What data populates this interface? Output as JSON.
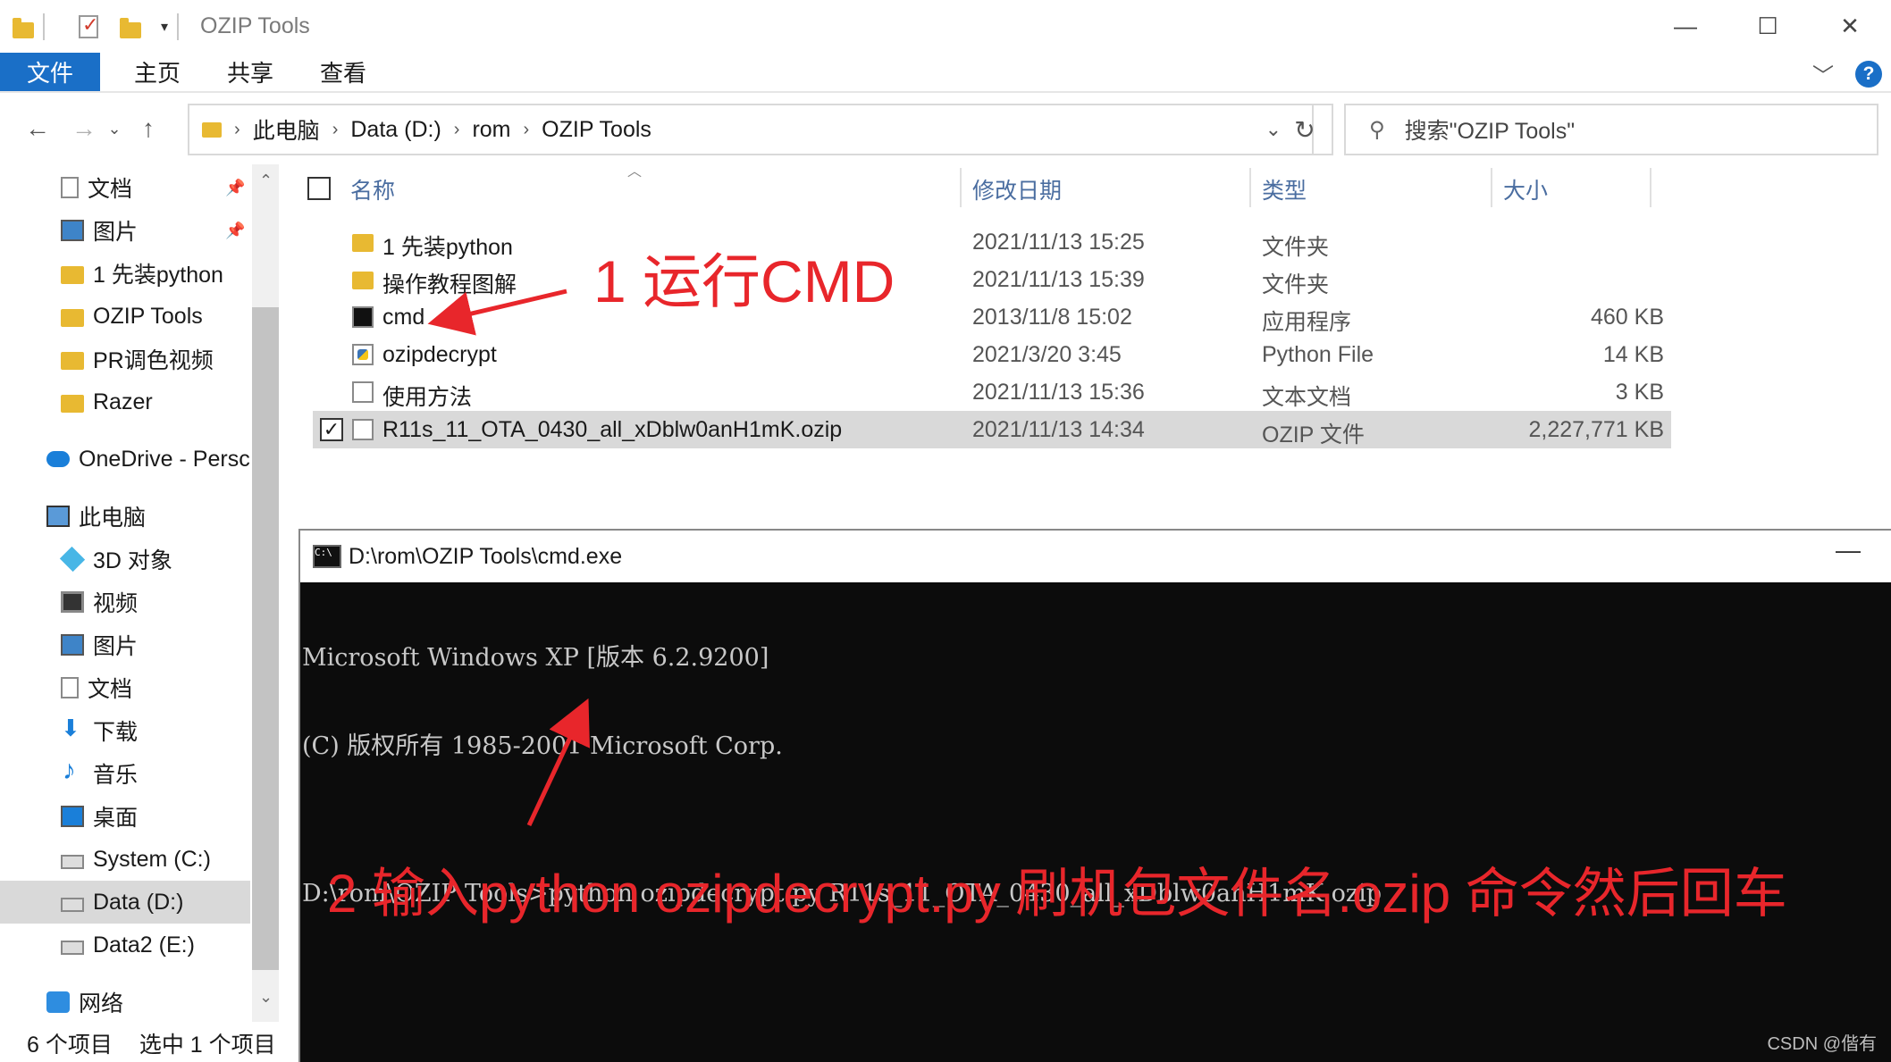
{
  "window": {
    "title": "OZIP Tools",
    "controls": {
      "minimize": "—",
      "maximize": "☐",
      "close": "✕"
    }
  },
  "ribbon": {
    "tabs": [
      "文件",
      "主页",
      "共享",
      "查看"
    ],
    "expand_icon": "chevron-down-icon",
    "help_label": "?"
  },
  "address": {
    "crumbs": [
      "此电脑",
      "Data (D:)",
      "rom",
      "OZIP Tools"
    ],
    "search_placeholder": "搜索\"OZIP Tools\""
  },
  "sidebar": {
    "items": [
      {
        "label": "文档",
        "icon": "document-icon",
        "pinned": true
      },
      {
        "label": "图片",
        "icon": "pictures-icon",
        "pinned": true
      },
      {
        "label": "1 先装python",
        "icon": "folder-icon"
      },
      {
        "label": "OZIP Tools",
        "icon": "folder-icon"
      },
      {
        "label": "PR调色视频",
        "icon": "folder-icon"
      },
      {
        "label": "Razer",
        "icon": "folder-icon"
      },
      {
        "label": "OneDrive - Persc",
        "icon": "onedrive-icon"
      },
      {
        "label": "此电脑",
        "icon": "this-pc-icon"
      },
      {
        "label": "3D 对象",
        "icon": "3d-objects-icon"
      },
      {
        "label": "视频",
        "icon": "videos-icon"
      },
      {
        "label": "图片",
        "icon": "pictures-icon"
      },
      {
        "label": "文档",
        "icon": "document-icon"
      },
      {
        "label": "下载",
        "icon": "downloads-icon"
      },
      {
        "label": "音乐",
        "icon": "music-icon"
      },
      {
        "label": "桌面",
        "icon": "desktop-icon"
      },
      {
        "label": "System (C:)",
        "icon": "drive-icon"
      },
      {
        "label": "Data (D:)",
        "icon": "drive-icon",
        "selected": true
      },
      {
        "label": "Data2 (E:)",
        "icon": "drive-icon"
      },
      {
        "label": "网络",
        "icon": "network-icon"
      }
    ]
  },
  "filelist": {
    "columns": [
      "名称",
      "修改日期",
      "类型",
      "大小"
    ],
    "rows": [
      {
        "name": "1 先装python",
        "date": "2021/11/13 15:25",
        "type": "文件夹",
        "size": "",
        "icon": "folder-icon"
      },
      {
        "name": "操作教程图解",
        "date": "2021/11/13 15:39",
        "type": "文件夹",
        "size": "",
        "icon": "folder-icon"
      },
      {
        "name": "cmd",
        "date": "2013/11/8 15:02",
        "type": "应用程序",
        "size": "460 KB",
        "icon": "cmd-icon"
      },
      {
        "name": "ozipdecrypt",
        "date": "2021/3/20 3:45",
        "type": "Python File",
        "size": "14 KB",
        "icon": "python-file-icon"
      },
      {
        "name": "使用方法",
        "date": "2021/11/13 15:36",
        "type": "文本文档",
        "size": "3 KB",
        "icon": "text-file-icon"
      },
      {
        "name": "R11s_11_OTA_0430_all_xDblw0anH1mK.ozip",
        "date": "2021/11/13 14:34",
        "type": "OZIP 文件",
        "size": "2,227,771 KB",
        "icon": "file-icon",
        "selected": true
      }
    ]
  },
  "status": {
    "count": "6 个项目",
    "selection": "选中 1 个项目"
  },
  "cmd": {
    "title": "D:\\rom\\OZIP Tools\\cmd.exe",
    "icon_text": "C:\\",
    "lines": [
      "Microsoft Windows XP [版本 6.2.9200]",
      "(C) 版权所有 1985-2001 Microsoft Corp.",
      "",
      "D:\\rom\\OZIP Tools>python ozipdecrypt.py R11s_11_OTA_0430_all_xDblw0anH1mK.ozip"
    ],
    "watermark": "CSDN @偕有"
  },
  "annotations": {
    "step1": "1 运行CMD",
    "step2": "2 输入python ozipdecrypt.py 刷机包文件名.ozip 命令然后回车"
  },
  "colors": {
    "accent": "#1a6fc7",
    "annotation": "#e8262b",
    "selection": "#d9d9d9",
    "console_bg": "#0c0c0c"
  }
}
